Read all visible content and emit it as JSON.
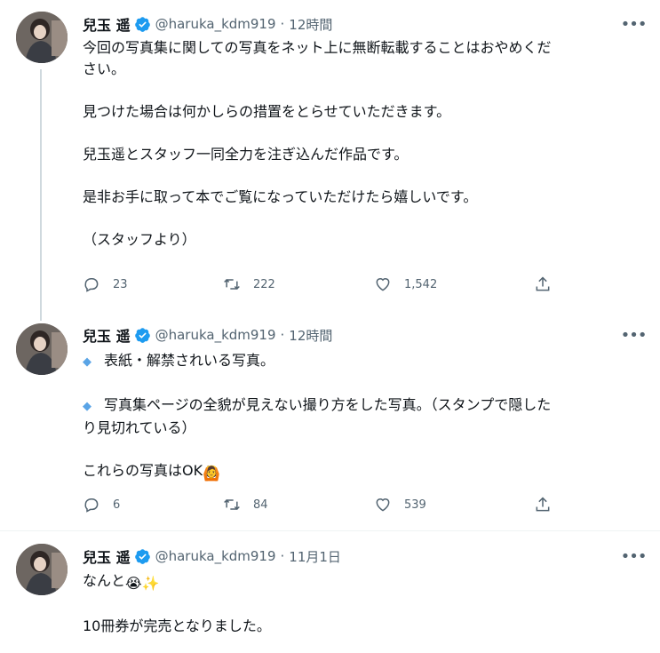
{
  "tweets": [
    {
      "name": "兒玉 遥",
      "handle": "@haruka_kdm919",
      "sep": "·",
      "time": "12時間",
      "lines": [
        "今回の写真集に関しての写真をネット上に無断転載することはおやめくだ",
        "さい。",
        "",
        "見つけた場合は何かしらの措置をとらせていただきます。",
        "",
        "兒玉遥とスタッフ一同全力を注ぎ込んだ作品です。",
        "",
        "是非お手に取って本でご覧になっていただけたら嬉しいです。",
        "",
        "（スタッフより）"
      ],
      "replies": "23",
      "retweets": "222",
      "likes": "1,542"
    },
    {
      "name": "兒玉 遥",
      "handle": "@haruka_kdm919",
      "sep": "·",
      "time": "12時間",
      "diamond_line_1": "表紙・解禁されいる写真。",
      "diamond_line_2a": "写真集ページの全貌が見えない撮り方をした写真。（スタンプで隠した",
      "diamond_line_2b": "り見切れている）",
      "ok_line": "これらの写真はOK",
      "ok_emoji": "🙆",
      "replies": "6",
      "retweets": "84",
      "likes": "539"
    },
    {
      "name": "兒玉 遥",
      "handle": "@haruka_kdm919",
      "sep": "·",
      "time": "11月1日",
      "line1": "なんと",
      "line1_emoji": "😭✨",
      "line2": "10冊券が完売となりました。"
    }
  ],
  "icons": {
    "reply": "reply-icon",
    "retweet": "retweet-icon",
    "like": "heart-icon",
    "share": "share-icon",
    "verified": "verified-badge-icon",
    "more": "more-icon",
    "diamond": "◆"
  },
  "colors": {
    "text": "#0f1419",
    "secondary": "#536471",
    "verified": "#1d9bf0",
    "diamond": "#5aa4e6",
    "divider": "#eff3f4"
  }
}
